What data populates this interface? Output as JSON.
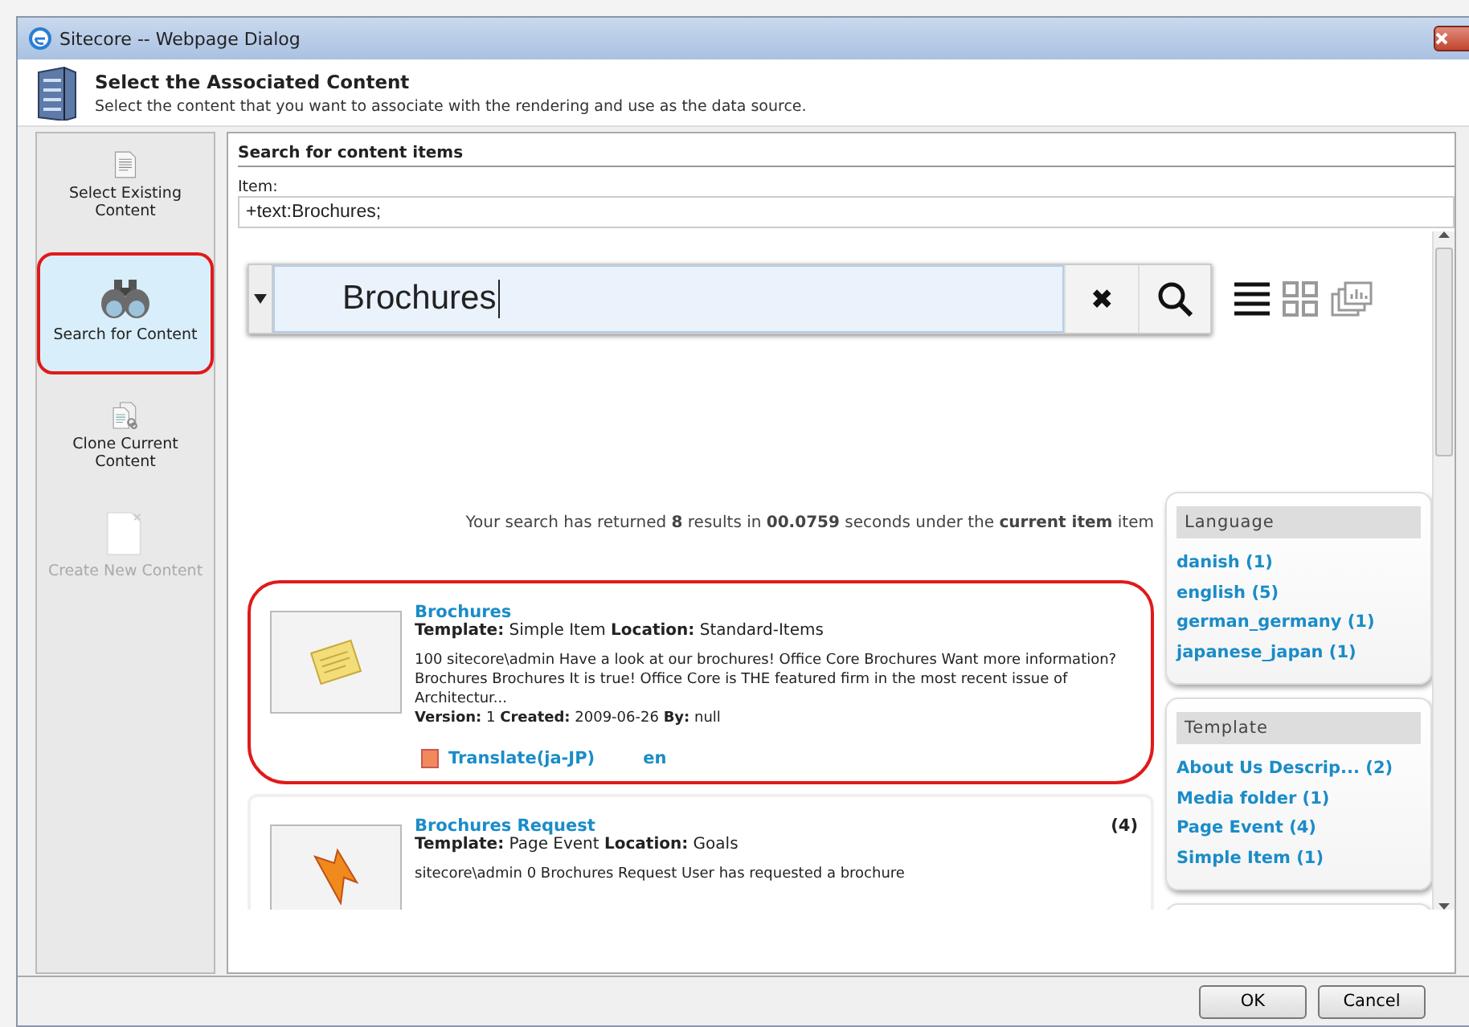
{
  "window": {
    "title": "Sitecore -- Webpage Dialog"
  },
  "header": {
    "title": "Select the Associated Content",
    "subtitle": "Select the content that you want to associate with the rendering and use as the data source."
  },
  "sidebar": {
    "items": [
      {
        "kind": "document",
        "label": "Select Existing Content",
        "selected": false,
        "disabled": false
      },
      {
        "kind": "binoculars",
        "label": "Search for Content",
        "selected": true,
        "disabled": false
      },
      {
        "kind": "clone",
        "label": "Clone Current Content",
        "selected": false,
        "disabled": false
      },
      {
        "kind": "new",
        "label": "Create New Content",
        "selected": false,
        "disabled": true
      }
    ]
  },
  "panel": {
    "heading": "Search for content items",
    "item_label": "Item:",
    "item_value": "+text:Brochures;",
    "search": {
      "value": "Brochures",
      "clear": "✖"
    },
    "views": [
      {
        "kind": "list",
        "selected": true
      },
      {
        "kind": "grid",
        "selected": false
      },
      {
        "kind": "gallery",
        "selected": false
      }
    ],
    "summary": "Your search has returned **8** results in **00.0759** seconds under the **current item** item",
    "results": [
      {
        "kind": "note",
        "title": "Brochures",
        "meta": "**Template:** Simple Item **Location:** Standard-Items",
        "description": "100 sitecore\\admin Have a look at our brochures! Office Core Brochures Want more information? Brochures Brochures It is true! Office Core is THE featured firm in the most recent issue of Architectur...",
        "version": "**Version:** 1 **Created:** 2009-06-26 **By:** null",
        "links": [
          "Translate(ja-JP)",
          "en"
        ],
        "highlighted": true
      },
      {
        "kind": "event",
        "title": "Brochures Request",
        "meta": "**Template:** Page Event **Location:** Goals",
        "count": "(4)",
        "description": "sitecore\\admin 0 Brochures Request User has requested a brochure",
        "highlighted": false
      }
    ],
    "facets": [
      {
        "title": "Language",
        "items": [
          "danish (1)",
          "english (5)",
          "german_germany (1)",
          "japanese_japan (1)"
        ]
      },
      {
        "title": "Template",
        "items": [
          "About Us Descrip... (2)",
          "Media folder (1)",
          "Page Event (4)",
          "Simple Item (1)"
        ]
      }
    ]
  },
  "buttons": [
    "OK",
    "Cancel"
  ]
}
